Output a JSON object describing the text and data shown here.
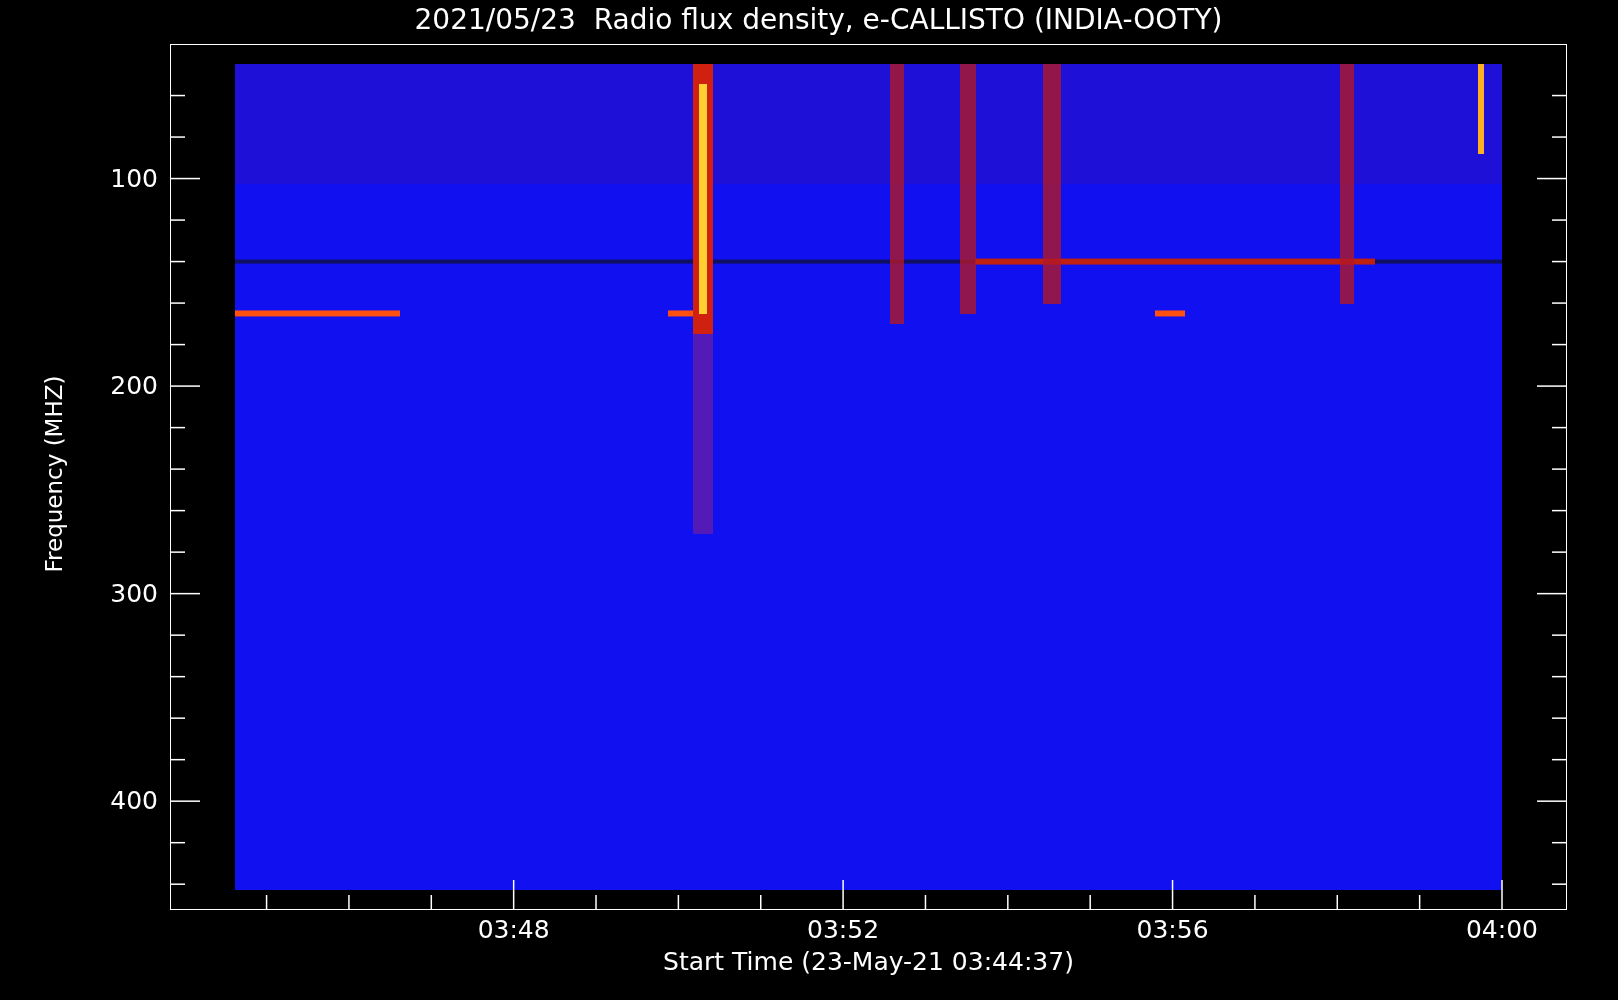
{
  "title": "2021/05/23  Radio flux density, e-CALLISTO (INDIA-OOTY)",
  "y_axis": {
    "label": "Frequency (MHZ)",
    "ticks": [
      "100",
      "200",
      "300",
      "400"
    ]
  },
  "x_axis": {
    "label": "Start Time (23-May-21 03:44:37)",
    "ticks": [
      "03:48",
      "03:52",
      "03:56",
      "04:00"
    ]
  }
}
